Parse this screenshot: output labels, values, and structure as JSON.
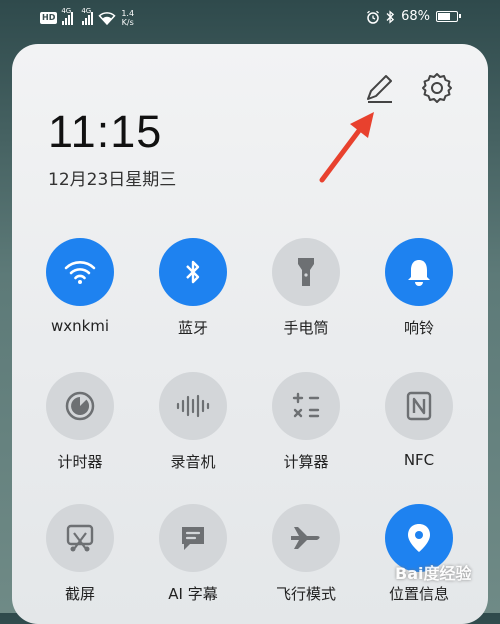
{
  "status_bar": {
    "hd_badge": "HD",
    "lte1": "4G",
    "lte2": "4G",
    "net_speed_value": "1.4",
    "net_speed_unit": "K/s",
    "battery_percent": "68%",
    "battery_level": 0.68,
    "icons": [
      "signal-icon",
      "wifi-icon",
      "alarm-icon",
      "bluetooth-icon",
      "battery-icon"
    ]
  },
  "panel": {
    "time": "11:15",
    "date": "12月23日星期三",
    "edit_icon": "pencil-icon",
    "settings_icon": "gear-icon",
    "annotation": "red-arrow"
  },
  "tiles": [
    {
      "label": "wxnkmi",
      "icon": "wifi-icon",
      "active": true
    },
    {
      "label": "蓝牙",
      "icon": "bluetooth-icon",
      "active": true
    },
    {
      "label": "手电筒",
      "icon": "flashlight-icon",
      "active": false
    },
    {
      "label": "响铃",
      "icon": "bell-icon",
      "active": true
    },
    {
      "label": "计时器",
      "icon": "timer-icon",
      "active": false
    },
    {
      "label": "录音机",
      "icon": "sound-wave-icon",
      "active": false
    },
    {
      "label": "计算器",
      "icon": "calculator-icon",
      "active": false
    },
    {
      "label": "NFC",
      "icon": "nfc-icon",
      "active": false
    },
    {
      "label": "截屏",
      "icon": "screenshot-icon",
      "active": false
    },
    {
      "label": "AI 字幕",
      "icon": "subtitle-icon",
      "active": false
    },
    {
      "label": "飞行模式",
      "icon": "airplane-icon",
      "active": false
    },
    {
      "label": "位置信息",
      "icon": "location-pin-icon",
      "active": true
    }
  ],
  "watermark": "Bai度经验",
  "colors": {
    "active": "#1e82f0",
    "inactive": "#d3d6d9",
    "arrow": "#e8412e"
  }
}
